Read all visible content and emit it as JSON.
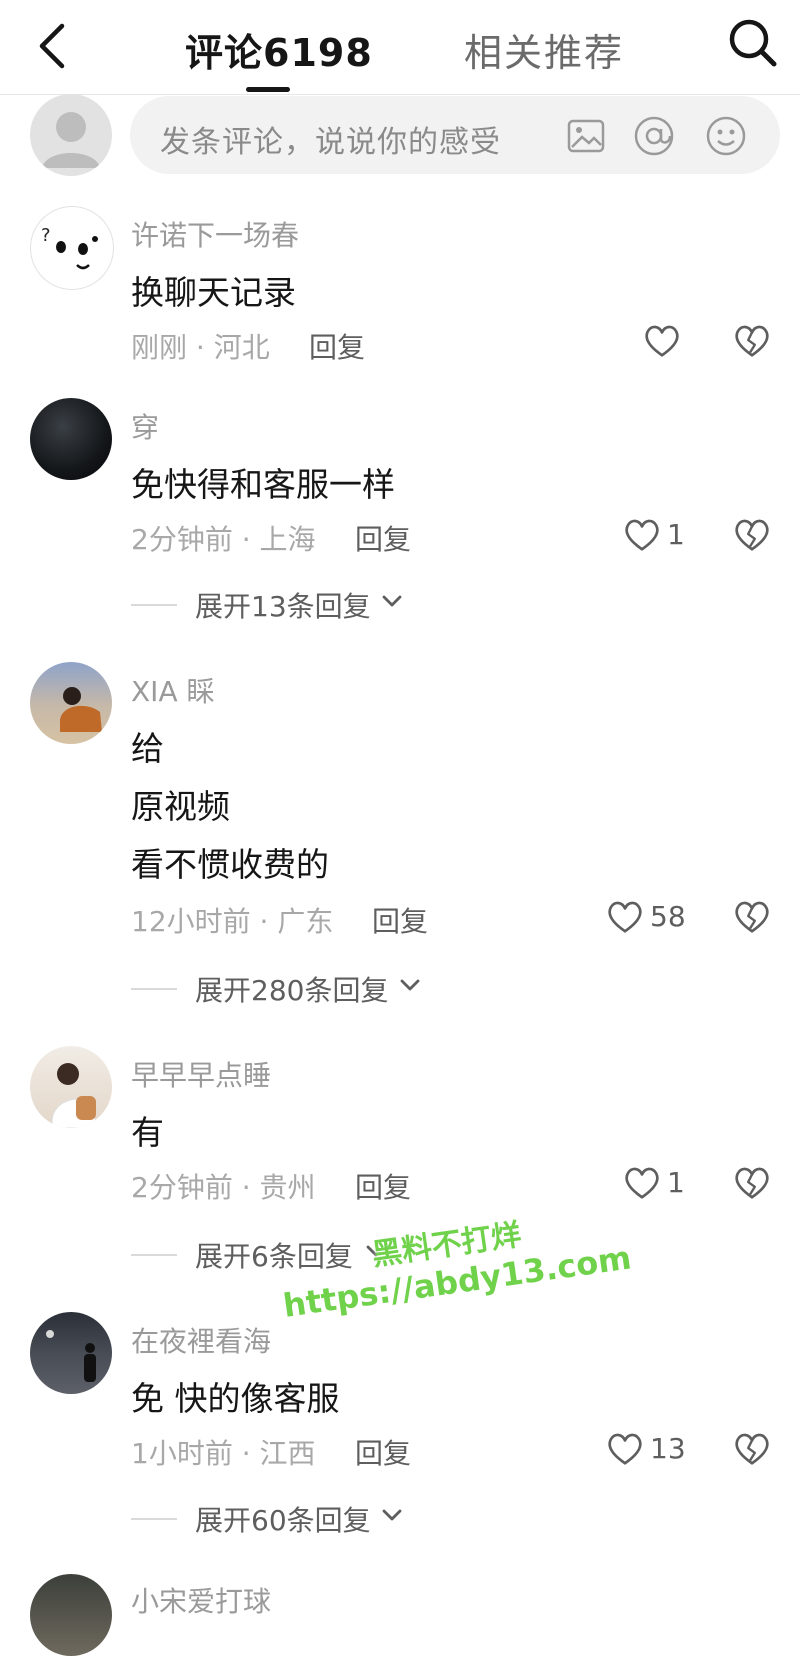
{
  "header": {
    "back_icon": "chevron-left-icon",
    "tab_comments": "评论6198",
    "tab_related": "相关推荐",
    "search_icon": "search-icon"
  },
  "composer": {
    "placeholder": "发条评论，说说你的感受",
    "image_icon": "image-icon",
    "at_icon": "at-icon",
    "emoji_icon": "emoji-icon"
  },
  "comments": [
    {
      "user": "许诺下一场春",
      "lines": [
        "换聊天记录"
      ],
      "time": "刚刚",
      "region": "河北",
      "reply": "回复",
      "likes": "",
      "expand": ""
    },
    {
      "user": "穿",
      "lines": [
        "免快得和客服一样"
      ],
      "time": "2分钟前",
      "region": "上海",
      "reply": "回复",
      "likes": "1",
      "expand": "展开13条回复"
    },
    {
      "user": "XIA 睬",
      "lines": [
        "给",
        "原视频",
        "看不惯收费的"
      ],
      "time": "12小时前",
      "region": "广东",
      "reply": "回复",
      "likes": "58",
      "expand": "展开280条回复"
    },
    {
      "user": "早早早点睡",
      "lines": [
        "有"
      ],
      "time": "2分钟前",
      "region": "贵州",
      "reply": "回复",
      "likes": "1",
      "expand": "展开6条回复"
    },
    {
      "user": "在夜裡看海",
      "lines": [
        "免 快的像客服"
      ],
      "time": "1小时前",
      "region": "江西",
      "reply": "回复",
      "likes": "13",
      "expand": "展开60条回复"
    },
    {
      "user": "小宋爱打球",
      "lines": [],
      "time": "",
      "region": "",
      "reply": "",
      "likes": "",
      "expand": ""
    }
  ],
  "meta_separator": "·",
  "watermark": {
    "line1": "黑料不打烊",
    "line2": "https://abdy13.com"
  },
  "colors": {
    "text": "#161616",
    "secondary": "#9a9a9a",
    "watermark": "#6fd24a"
  }
}
